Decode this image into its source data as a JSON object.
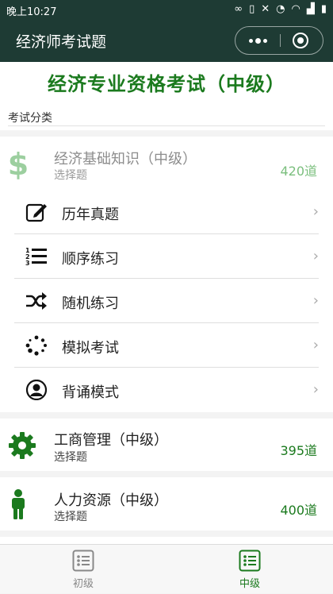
{
  "status_bar": {
    "time": "晚上10:27"
  },
  "app": {
    "title": "经济师考试题"
  },
  "headline": "经济专业资格考试（中级）",
  "section_label": "考试分类",
  "categories": [
    {
      "name": "经济基础知识（中级）",
      "subtitle": "选择题",
      "count": "420道",
      "icon": "dollar-icon"
    },
    {
      "name": "工商管理（中级）",
      "subtitle": "选择题",
      "count": "395道",
      "icon": "gear-icon"
    },
    {
      "name": "人力资源（中级）",
      "subtitle": "选择题",
      "count": "400道",
      "icon": "person-icon"
    }
  ],
  "menu": [
    {
      "label": "历年真题",
      "icon": "edit-icon"
    },
    {
      "label": "顺序练习",
      "icon": "ordered-list-icon"
    },
    {
      "label": "随机练习",
      "icon": "shuffle-icon"
    },
    {
      "label": "模拟考试",
      "icon": "spinner-icon"
    },
    {
      "label": "背诵模式",
      "icon": "user-circle-icon"
    }
  ],
  "tabs": [
    {
      "label": "初级",
      "active": false
    },
    {
      "label": "中级",
      "active": true
    }
  ],
  "colors": {
    "header": "#1e3b34",
    "accent": "#1b7a1e",
    "muted_accent": "#7bbf7e"
  }
}
